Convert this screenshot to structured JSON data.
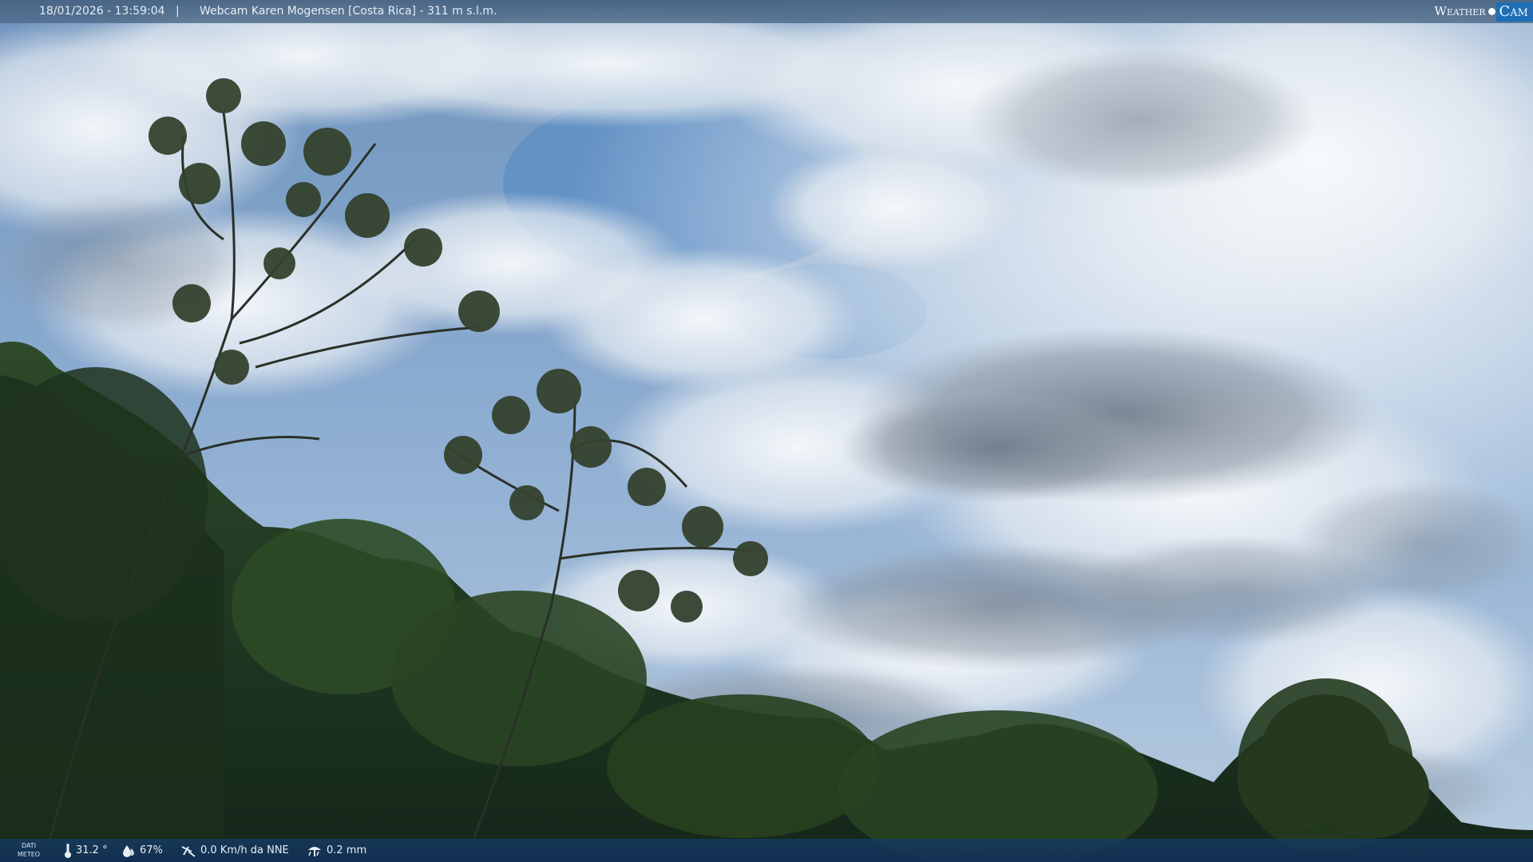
{
  "overlay": {
    "datetime": "18/01/2026 - 13:59:04",
    "separator": "|",
    "camera_title": "Webcam Karen Mogensen [Costa Rica] - 311 m s.l.m.",
    "brand_left": "Weather",
    "brand_right": "Cam"
  },
  "weather": {
    "label": "DATI METEO",
    "temperature": "31.2 °",
    "humidity": "67%",
    "wind": "0.0 Km/h da NNE",
    "rain": "0.2 mm"
  },
  "icons": {
    "temperature": "thermometer-icon",
    "humidity": "water-drop-icon",
    "wind": "wind-icon",
    "rain": "rain-gauge-icon",
    "brand": "weathercam-logo"
  },
  "colors": {
    "top_bar": "#4f6e8e",
    "bottom_bar": "#163a60",
    "brand_accent": "#1d6fb8",
    "sky_blue": "#5f8fc4",
    "foliage": "#1f3a1c"
  }
}
